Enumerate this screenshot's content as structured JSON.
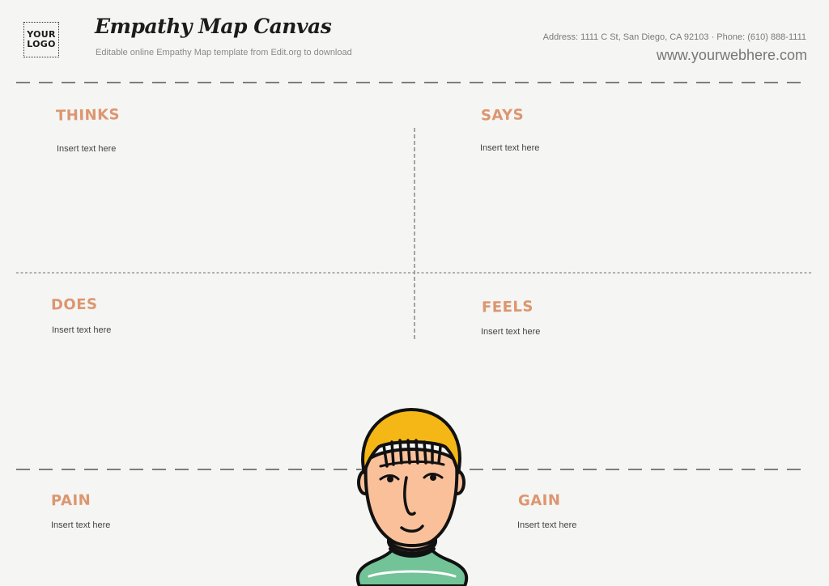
{
  "header": {
    "logo_line1": "YOUR",
    "logo_line2": "LOGO",
    "title": "Empathy Map Canvas",
    "subtitle": "Editable online Empathy Map template from Edit.org to download",
    "address": "Address: 1111 C St, San Diego, CA 92103 · Phone: (610) 888-1111",
    "website": "www.yourwebhere.com"
  },
  "sections": {
    "thinks": {
      "title": "THINKS",
      "body": "Insert text here"
    },
    "says": {
      "title": "SAYS",
      "body": "Insert text here"
    },
    "does": {
      "title": "DOES",
      "body": "Insert text here"
    },
    "feels": {
      "title": "FEELS",
      "body": "Insert text here"
    },
    "pain": {
      "title": "PAIN",
      "body": "Insert text here"
    },
    "gain": {
      "title": "GAIN",
      "body": "Insert text here"
    }
  },
  "colors": {
    "accent": "#dc9670",
    "background": "#f5f5f3",
    "hair": "#f5b715",
    "skin": "#f9c09a",
    "shirt": "#72c397"
  },
  "illustration": {
    "name": "person-character"
  }
}
